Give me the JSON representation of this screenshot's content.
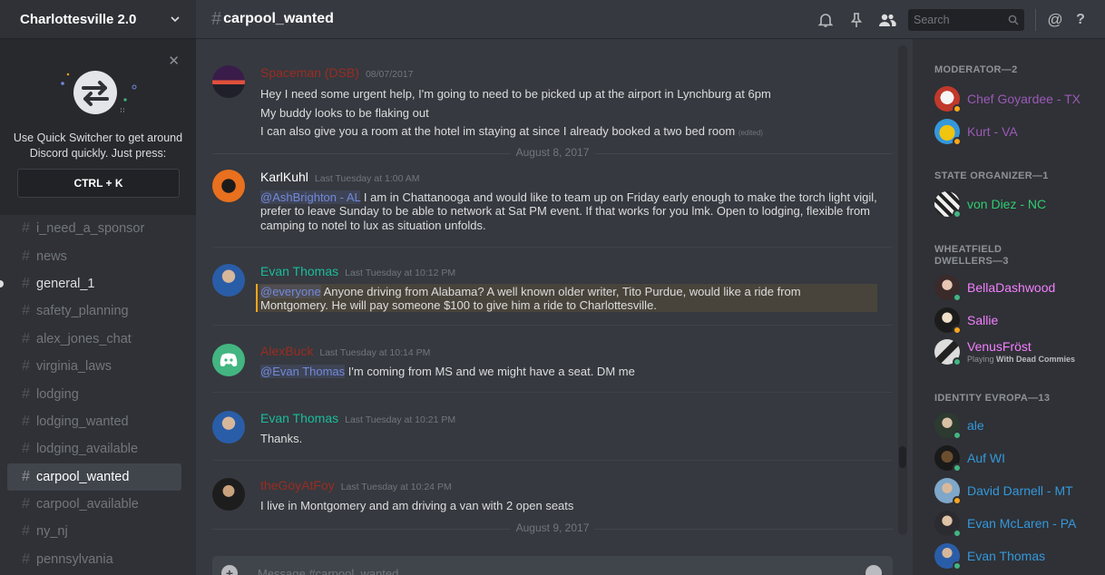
{
  "server": {
    "name": "Charlottesville 2.0"
  },
  "quick_switcher": {
    "text": "Use Quick Switcher to get around Discord quickly. Just press:",
    "shortcut": "CTRL + K"
  },
  "channels": [
    {
      "name": "i_need_a_sponsor",
      "state": "muted"
    },
    {
      "name": "news",
      "state": "muted"
    },
    {
      "name": "general_1",
      "state": "unread"
    },
    {
      "name": "safety_planning",
      "state": "muted"
    },
    {
      "name": "alex_jones_chat",
      "state": "muted"
    },
    {
      "name": "virginia_laws",
      "state": "muted"
    },
    {
      "name": "lodging",
      "state": "muted"
    },
    {
      "name": "lodging_wanted",
      "state": "muted"
    },
    {
      "name": "lodging_available",
      "state": "muted"
    },
    {
      "name": "carpool_wanted",
      "state": "active"
    },
    {
      "name": "carpool_available",
      "state": "muted"
    },
    {
      "name": "ny_nj",
      "state": "muted"
    },
    {
      "name": "pennsylvania",
      "state": "muted"
    }
  ],
  "topbar": {
    "channel_name": "carpool_wanted",
    "search_placeholder": "Search"
  },
  "messages": {
    "m1": {
      "author": "Spaceman (DSB)",
      "author_color": "#992d22",
      "timestamp": "08/07/2017",
      "lines": [
        "Hey I need some urgent help, I'm going to need to be picked up at the airport in Lynchburg at 6pm",
        "My buddy looks to be flaking out",
        "I can also give you a room at the hotel im staying at since I already booked a two bed room"
      ],
      "edited": "(edited)"
    },
    "date1": "August 8, 2017",
    "m2": {
      "author": "KarlKuhl",
      "author_color": "#ffffff",
      "timestamp": "Last Tuesday at 1:00 AM",
      "mention": "@AshBrighton - AL",
      "line1": " I am in Chattanooga and would like to team up  on Friday early enough to make the torch light vigil,",
      "line2": "prefer to leave Sunday to be able to network at Sat PM event. If that works for you lmk. Open to lodging, flexible from",
      "line3": "camping to notel to lux as situation unfolds."
    },
    "m3": {
      "author": "Evan Thomas",
      "author_color": "#1abc9c",
      "timestamp": "Last Tuesday at 10:12 PM",
      "mention": "@everyone",
      "line1": " Anyone driving from Alabama? A well known older writer, Tito Purdue, would like a ride from",
      "line2": "Montgomery. He will pay someone $100 to give him a ride to Charlottesville."
    },
    "m4": {
      "author": "AlexBuck",
      "author_color": "#992d22",
      "timestamp": "Last Tuesday at 10:14 PM",
      "mention": "@Evan Thomas",
      "line1": " I'm coming from MS and we might have a seat. DM me"
    },
    "m5": {
      "author": "Evan Thomas",
      "author_color": "#1abc9c",
      "timestamp": "Last Tuesday at 10:21 PM",
      "line1": "Thanks."
    },
    "m6": {
      "author": "theGoyAtFoy",
      "author_color": "#992d22",
      "timestamp": "Last Tuesday at 10:24 PM",
      "line1": "I live in Montgomery and am driving a van with 2 open seats"
    },
    "date2": "August 9, 2017"
  },
  "composer": {
    "placeholder": "Message #carpool_wanted"
  },
  "members": {
    "g1": {
      "label": "MODERATOR—2"
    },
    "mod1": {
      "name": "Chef Goyardee - TX",
      "color": "#9b59b6",
      "status": "idle"
    },
    "mod2": {
      "name": "Kurt - VA",
      "color": "#9b59b6",
      "status": "idle"
    },
    "g2": {
      "label": "STATE ORGANIZER—1"
    },
    "org1": {
      "name": "von Diez - NC",
      "color": "#2ecc71",
      "status": "online"
    },
    "g3": {
      "label": "WHEATFIELD DWELLERS—3"
    },
    "wd1": {
      "name": "BellaDashwood",
      "color": "#f47fff",
      "status": "online"
    },
    "wd2": {
      "name": "Sallie",
      "color": "#f47fff",
      "status": "idle"
    },
    "wd3": {
      "name": "VenusFröst",
      "color": "#f47fff",
      "status": "online",
      "playing_prefix": "Playing ",
      "playing_game": "With Dead Commies"
    },
    "g4": {
      "label": "IDENTITY EVROPA—13"
    },
    "ie1": {
      "name": "ale",
      "color": "#3498db",
      "status": "online"
    },
    "ie2": {
      "name": "Auf WI",
      "color": "#3498db",
      "status": "online"
    },
    "ie3": {
      "name": "David Darnell - MT",
      "color": "#3498db",
      "status": "idle"
    },
    "ie4": {
      "name": "Evan McLaren - PA",
      "color": "#3498db",
      "status": "online"
    },
    "ie5": {
      "name": "Evan Thomas",
      "color": "#3498db",
      "status": "online"
    }
  },
  "colors": {
    "online": "#43b581",
    "idle": "#faa61a",
    "mention": "#7289da"
  }
}
